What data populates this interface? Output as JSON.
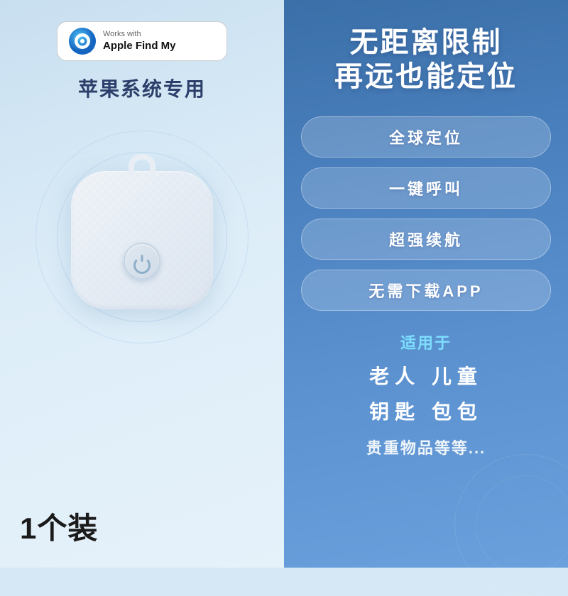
{
  "left": {
    "badge": {
      "works_with": "Works with",
      "brand": "Apple Find My"
    },
    "system_label": "苹果系统专用",
    "quantity": "1个装"
  },
  "right": {
    "headline_line1": "无距离限制",
    "headline_line2": "再远也能定位",
    "features": [
      "全球定位",
      "一键呼叫",
      "超强续航",
      "无需下载APP"
    ],
    "applicable_label": "适用于",
    "applicable_row1": "老人    儿童",
    "applicable_row2": "钥匙    包包",
    "applicable_row3": "贵重物品等等..."
  }
}
